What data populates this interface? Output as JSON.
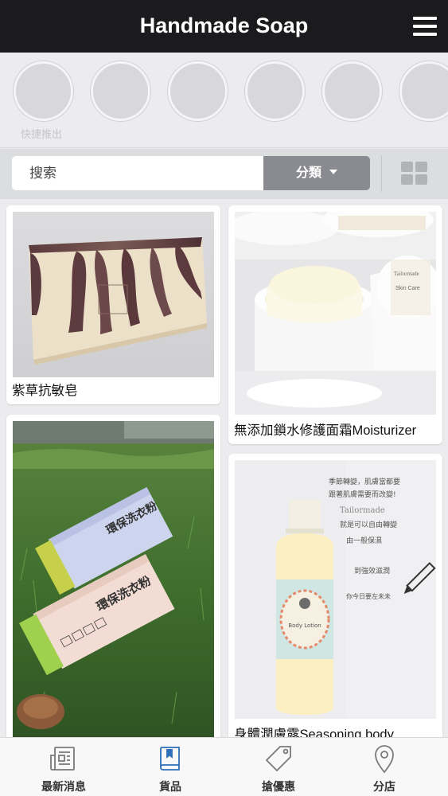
{
  "header": {
    "title": "Handmade Soap"
  },
  "stories": {
    "label": "快捷推出"
  },
  "search": {
    "placeholder": "搜索"
  },
  "category_button": {
    "label": "分類"
  },
  "products": [
    {
      "name": "紫草抗敏皂"
    },
    {
      "name": "無添加鎖水修護面霜Moisturizer"
    },
    {
      "name": ""
    },
    {
      "name": "身體潤膚露Seasoning body"
    }
  ],
  "lotion_card_text": {
    "line1": "季節轉變，肌膚當都要",
    "line2": "跟著肌膚需要而改變!",
    "line3": "Tailormade",
    "line4": "就是可以自由轉變",
    "line5": "由一般保濕",
    "line6": "到強效滋潤",
    "line7": "你今日要左未未",
    "bottle_brand": "Body Lotion"
  },
  "box_text": {
    "text": "環保洗衣粉"
  },
  "tabs": [
    {
      "label": "最新消息",
      "icon": "newspaper-icon"
    },
    {
      "label": "貨品",
      "icon": "book-icon"
    },
    {
      "label": "搶優惠",
      "icon": "tag-icon"
    },
    {
      "label": "分店",
      "icon": "location-pin-icon"
    }
  ],
  "colors": {
    "header_bg": "#1b1b1d",
    "active_tab": "#2f6fb7",
    "category_btn": "#8a8b90"
  }
}
